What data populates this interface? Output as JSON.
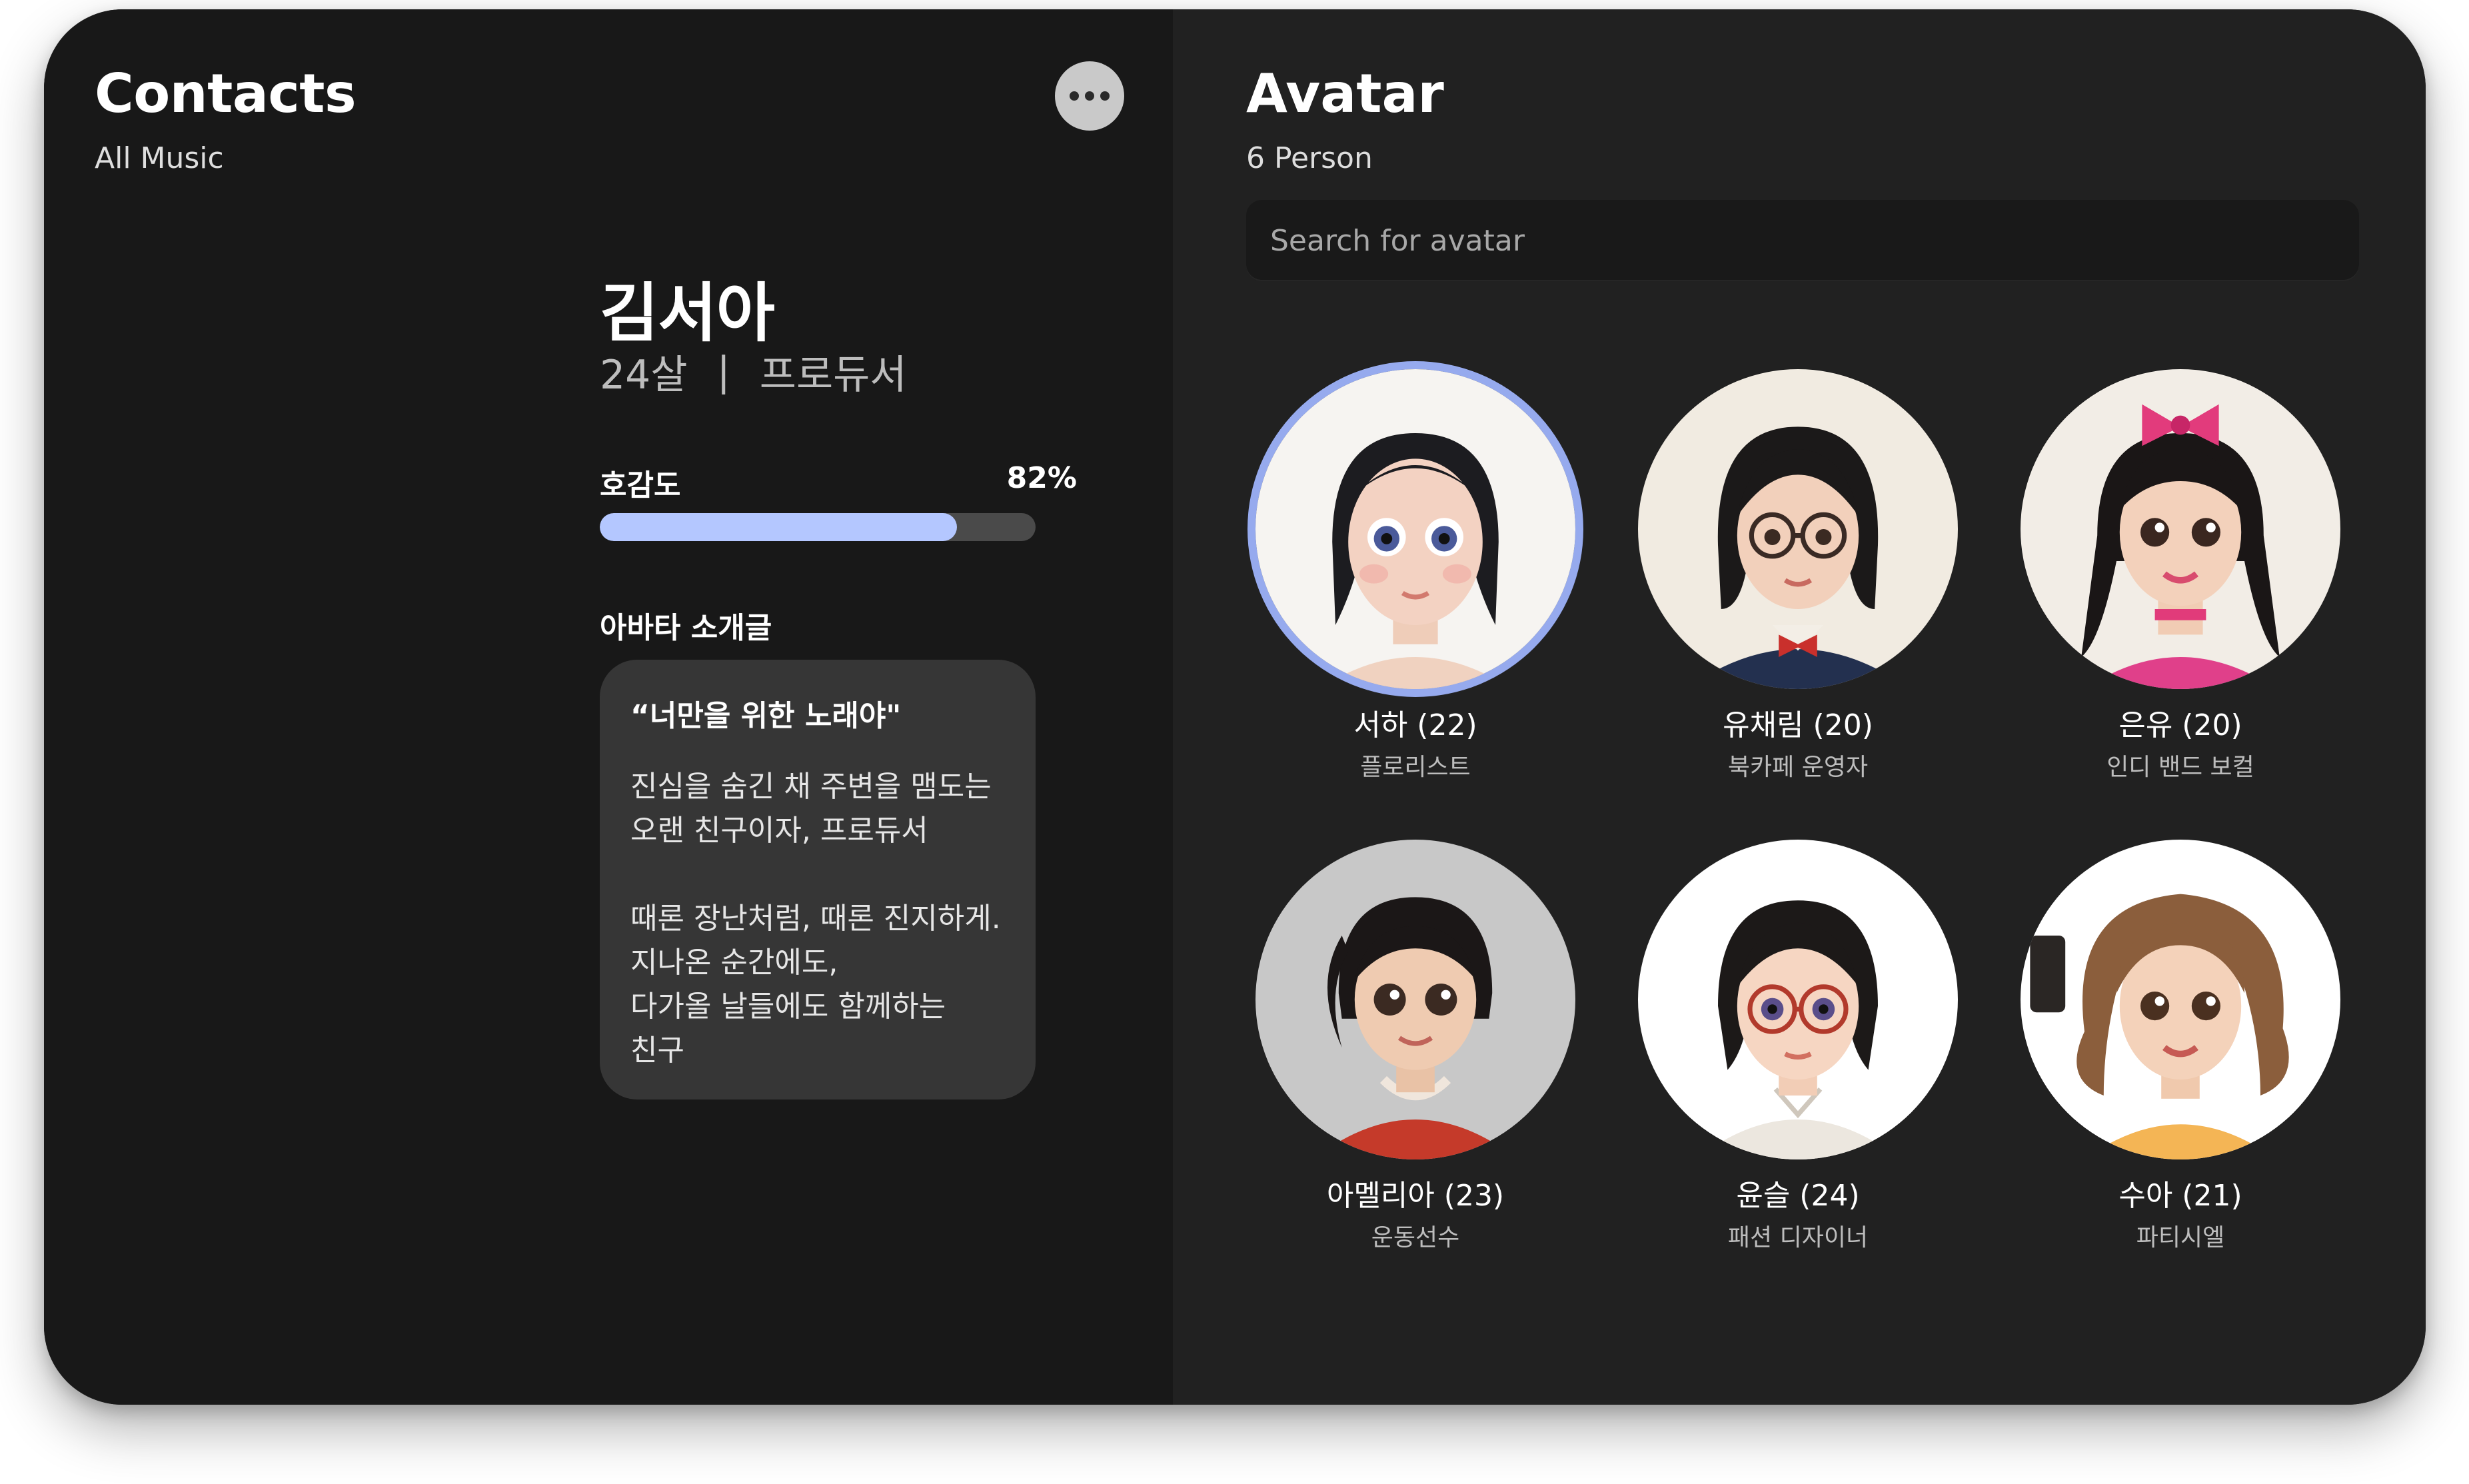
{
  "contacts": {
    "title": "Contacts",
    "subtitle": "All Music",
    "more_icon": "more-horizontal-icon"
  },
  "profile": {
    "name": "김서아",
    "age": "24살",
    "separator": "|",
    "job": "프로듀서",
    "affinity_label": "호감도",
    "affinity_value": "82%",
    "affinity_fraction": 0.82,
    "intro_heading": "아바타 소개글",
    "intro_quote": "“너만을 위한 노래야\"",
    "intro_lines": [
      "진심을 숨긴 채 주변을 맴도는",
      "오랜 친구이자, 프로듀서",
      "",
      "때론 장난처럼, 때론 진지하게.",
      "지나온 순간에도,",
      "다가올 날들에도 함께하는",
      "친구"
    ]
  },
  "avatar_panel": {
    "title": "Avatar",
    "subtitle": "6 Person",
    "search_placeholder": "Search for avatar",
    "avatars": [
      {
        "name": "서하 (22)",
        "role": "플로리스트",
        "selected": true
      },
      {
        "name": "유채림 (20)",
        "role": "북카페 운영자",
        "selected": false
      },
      {
        "name": "은유 (20)",
        "role": "인디 밴드 보컬",
        "selected": false
      },
      {
        "name": "아멜리아 (23)",
        "role": "운동선수",
        "selected": false
      },
      {
        "name": "윤슬 (24)",
        "role": "패션 디자이너",
        "selected": false
      },
      {
        "name": "수아 (21)",
        "role": "파티시엘",
        "selected": false
      }
    ]
  },
  "colors": {
    "left_bg": "#181818",
    "right_bg": "#212121",
    "accent": "#b4c7ff",
    "selected_ring": "#96aaee",
    "card_bg": "#363636"
  }
}
